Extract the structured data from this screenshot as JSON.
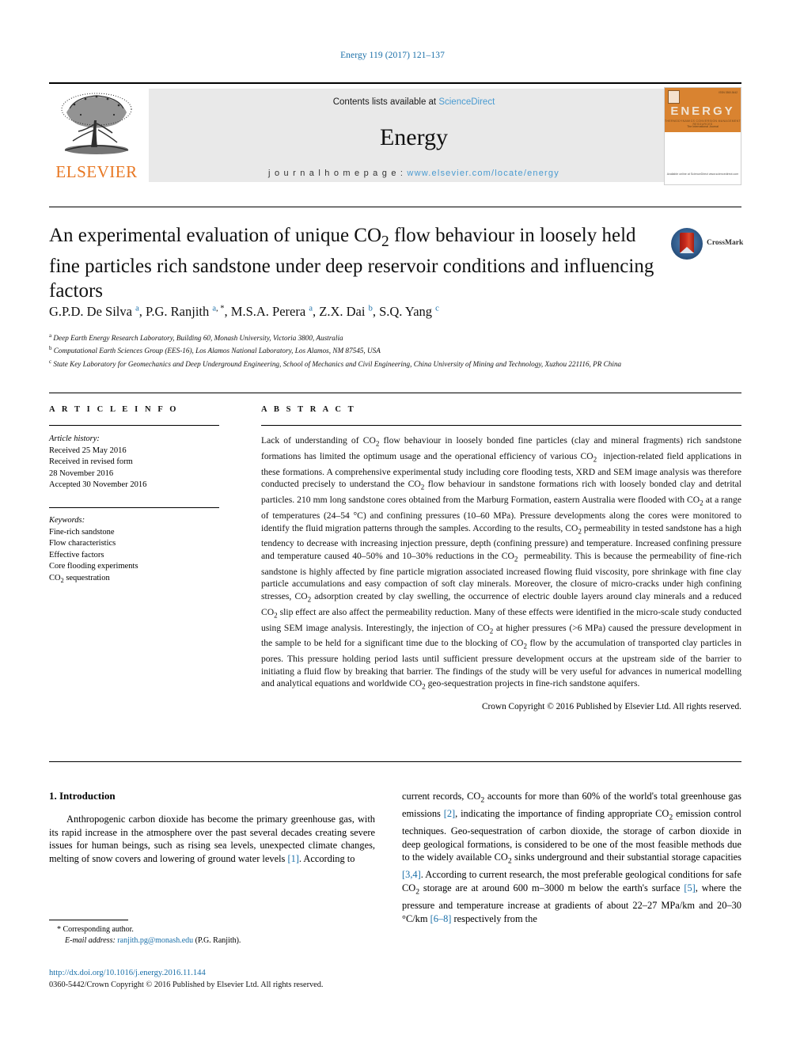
{
  "running_head": "Energy 119 (2017) 121–137",
  "masthead": {
    "publisher_name": "ELSEVIER",
    "contents_prefix": "Contents lists available at ",
    "contents_link": "ScienceDirect",
    "journal_title": "Energy",
    "homepage_label": "j o u r n a l   h o m e p a g e :  ",
    "homepage_url": "www.elsevier.com/locate/energy",
    "cover": {
      "brand": "ENERGY",
      "code": "ISSN 0360-5442",
      "columns": "THERMODYNAMICS   CONVERSION   MANAGEMENT   RESOURCES",
      "tagline": "The International Journal",
      "footer": "Available online at\nScienceDirect\nwww.sciencedirect.com"
    }
  },
  "article": {
    "title": "An experimental evaluation of unique CO2 flow behaviour in loosely held fine particles rich sandstone under deep reservoir conditions and influencing factors",
    "crossmark_label": "CrossMark",
    "authors": [
      {
        "name": "G.P.D. De Silva",
        "marks": "a"
      },
      {
        "name": "P.G. Ranjith",
        "marks": "a, *"
      },
      {
        "name": "M.S.A. Perera",
        "marks": "a"
      },
      {
        "name": "Z.X. Dai",
        "marks": "b"
      },
      {
        "name": "S.Q. Yang",
        "marks": "c"
      }
    ],
    "affiliations": [
      {
        "mark": "a",
        "text": "Deep Earth Energy Research Laboratory, Building 60, Monash University, Victoria 3800, Australia"
      },
      {
        "mark": "b",
        "text": "Computational Earth Sciences Group (EES-16), Los Alamos National Laboratory, Los Alamos, NM 87545, USA"
      },
      {
        "mark": "c",
        "text": "State Key Laboratory for Geomechanics and Deep Underground Engineering, School of Mechanics and Civil Engineering, China University of Mining and Technology, Xuzhou 221116, PR China"
      }
    ]
  },
  "article_info": {
    "heading": "A R T I C L E   I N F O",
    "history_label": "Article history:",
    "history": [
      "Received 25 May 2016",
      "Received in revised form",
      "28 November 2016",
      "Accepted 30 November 2016"
    ],
    "keywords_label": "Keywords:",
    "keywords": [
      "Fine-rich sandstone",
      "Flow characteristics",
      "Effective factors",
      "Core flooding experiments",
      "CO2 sequestration"
    ]
  },
  "abstract": {
    "heading": "A B S T R A C T",
    "text": "Lack of understanding of CO2 flow behaviour in loosely bonded fine particles (clay and mineral fragments) rich sandstone formations has limited the optimum usage and the operational efficiency of various CO2 injection-related field applications in these formations. A comprehensive experimental study including core flooding tests, XRD and SEM image analysis was therefore conducted precisely to understand the CO2 flow behaviour in sandstone formations rich with loosely bonded clay and detrital particles. 210 mm long sandstone cores obtained from the Marburg Formation, eastern Australia were flooded with CO2 at a range of temperatures (24–54 °C) and confining pressures (10–60 MPa). Pressure developments along the cores were monitored to identify the fluid migration patterns through the samples. According to the results, CO2 permeability in tested sandstone has a high tendency to decrease with increasing injection pressure, depth (confining pressure) and temperature. Increased confining pressure and temperature caused 40–50% and 10–30% reductions in the CO2 permeability. This is because the permeability of fine-rich sandstone is highly affected by fine particle migration associated increased flowing fluid viscosity, pore shrinkage with fine clay particle accumulations and easy compaction of soft clay minerals. Moreover, the closure of micro-cracks under high confining stresses, CO2 adsorption created by clay swelling, the occurrence of electric double layers around clay minerals and a reduced CO2 slip effect are also affect the permeability reduction. Many of these effects were identified in the micro-scale study conducted using SEM image analysis. Interestingly, the injection of CO2 at higher pressures (>6 MPa) caused the pressure development in the sample to be held for a significant time due to the blocking of CO2 flow by the accumulation of transported clay particles in pores. This pressure holding period lasts until sufficient pressure development occurs at the upstream side of the barrier to initiating a fluid flow by breaking that barrier. The findings of the study will be very useful for advances in numerical modelling and analytical equations and worldwide CO2 geo-sequestration projects in fine-rich sandstone aquifers.",
    "copyright": "Crown Copyright © 2016 Published by Elsevier Ltd. All rights reserved."
  },
  "body": {
    "section_heading": "1.  Introduction",
    "left_paragraph": "Anthropogenic carbon dioxide has become the primary greenhouse gas, with its rapid increase in the atmosphere over the past several decades creating severe issues for human beings, such as rising sea levels, unexpected climate changes, melting of snow covers and lowering of ground water levels [1]. According to",
    "right_paragraph": "current records, CO2 accounts for more than 60% of the world's total greenhouse gas emissions [2], indicating the importance of finding appropriate CO2 emission control techniques. Geo-sequestration of carbon dioxide, the storage of carbon dioxide in deep geological formations, is considered to be one of the most feasible methods due to the widely available CO2 sinks underground and their substantial storage capacities [3,4]. According to current research, the most preferable geological conditions for safe CO2 storage are at around 600 m–3000 m below the earth's surface [5], where the pressure and temperature increase at gradients of about 22–27 MPa/km and 20–30 °C/km [6–8] respectively from the"
  },
  "footer": {
    "corresponding_marker": "*",
    "corresponding_label": "Corresponding author.",
    "email_label": "E-mail address:",
    "email": "ranjith.pg@monash.edu",
    "email_owner": "(P.G. Ranjith).",
    "doi": "http://dx.doi.org/10.1016/j.energy.2016.11.144",
    "issn_line": "0360-5442/Crown Copyright © 2016 Published by Elsevier Ltd. All rights reserved."
  },
  "colors": {
    "link": "#1a6fa8",
    "science_direct": "#4a9bd1",
    "elsevier_orange": "#E87722",
    "banner_bg": "#e9e9e9",
    "cover_orange": "#d98330"
  }
}
